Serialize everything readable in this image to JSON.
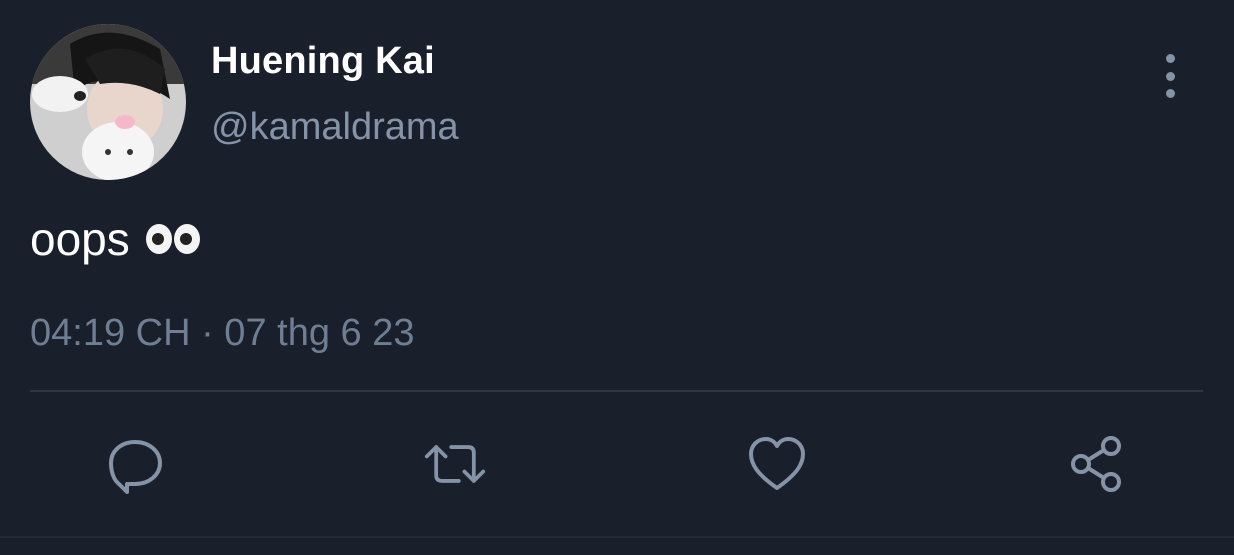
{
  "tweet": {
    "author": {
      "display_name": "Huening Kai",
      "handle": "@kamaldrama"
    },
    "text": "oops",
    "emoji": "eyes",
    "timestamp": "04:19 CH · 07 thg 6 23"
  },
  "icons": {
    "more": "more-vertical-icon",
    "reply": "reply-icon",
    "retweet": "retweet-icon",
    "like": "heart-icon",
    "share": "share-icon"
  },
  "colors": {
    "background": "#1a202b",
    "secondary_text": "#8493a7",
    "icon": "#8493a7"
  }
}
